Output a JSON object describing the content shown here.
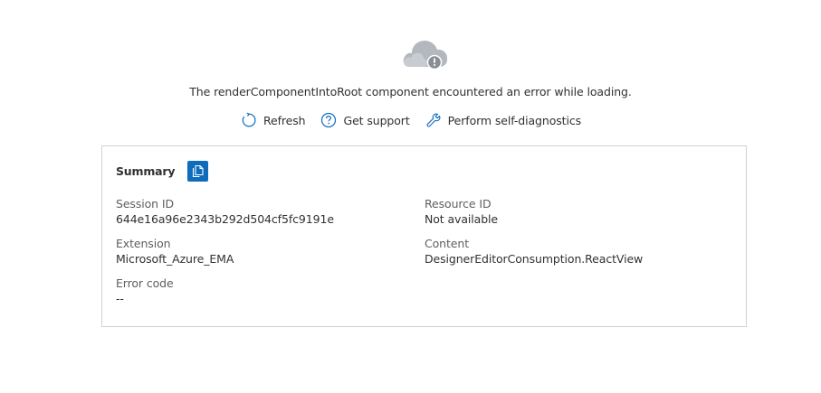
{
  "error": {
    "message": "The renderComponentIntoRoot component encountered an error while loading."
  },
  "actions": [
    {
      "label": "Refresh",
      "icon": "refresh-icon"
    },
    {
      "label": "Get support",
      "icon": "question-circle-icon"
    },
    {
      "label": "Perform self-diagnostics",
      "icon": "wrench-icon"
    }
  ],
  "summary": {
    "title": "Summary",
    "copy_icon": "copy-icon",
    "fields": {
      "session_id": {
        "label": "Session ID",
        "value": "644e16a96e2343b292d504cf5fc9191e"
      },
      "resource_id": {
        "label": "Resource ID",
        "value": "Not available"
      },
      "extension": {
        "label": "Extension",
        "value": "Microsoft_Azure_EMA"
      },
      "content": {
        "label": "Content",
        "value": "DesignerEditorConsumption.ReactView"
      },
      "error_code": {
        "label": "Error code",
        "value": "--"
      }
    }
  },
  "colors": {
    "accent": "#0f6cbd",
    "icon": "#0f6cbd",
    "cloud": "#b3b8bf",
    "border": "#d1d1d1"
  }
}
